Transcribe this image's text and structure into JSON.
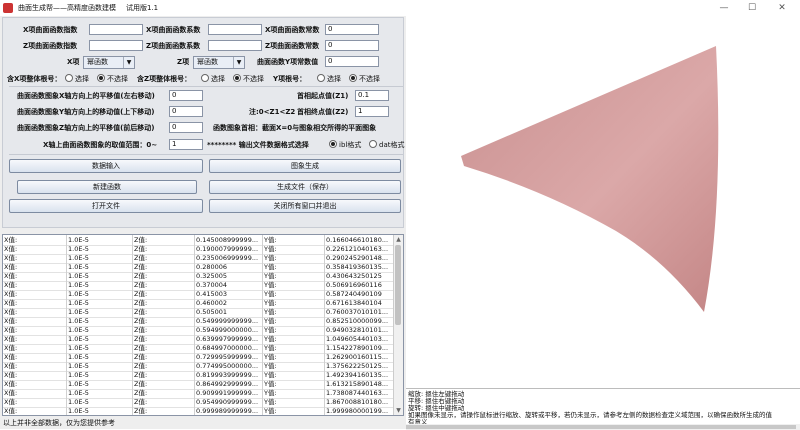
{
  "window": {
    "title": "曲面生成帮——高精度函数建模",
    "version": "试用版1.1",
    "controls": [
      "—",
      "☐",
      "✕"
    ]
  },
  "form": {
    "x_exp_label": "X项曲面函数指数",
    "x_coef_label": "X项曲面函数系数",
    "x_const_label": "X项曲面函数常数",
    "x_const_value": "0",
    "z_exp_label": "Z项曲面函数指数",
    "z_coef_label": "Z项曲面函数系数",
    "z_const_label": "Z项曲面函数常数",
    "z_const_value": "0",
    "x_term_label": "X项",
    "x_term_select": "幂函数",
    "z_term_label": "Z项",
    "z_term_select": "幂函数",
    "y_const_label": "曲面函数Y项常数值",
    "y_const_value": "0",
    "x_sign_label": "含X项整体根号：",
    "z_sign_label": "含Z项整体根号：",
    "y_sign_label": "Y项根号：",
    "opt_select": "选择",
    "opt_unselect": "不选择",
    "x_shift_label": "曲面函数图象X轴方向上的平移值(左右移动)",
    "x_shift_value": "0",
    "y_shift_label": "曲面函数图象Y轴方向上的移动值(上下移动)",
    "y_shift_value": "0",
    "z_shift_label": "曲面函数图象Z轴方向上的平移值(前后移动)",
    "z_shift_value": "0",
    "z1_label": "首相起点值(Z1)",
    "z1_value": "0.1",
    "z2_label": "首相终点值(Z2)",
    "z2_value": "1",
    "note_label": "注:0<Z1<Z2",
    "first_term_note": "函数图象首相：截面X=0与图象相交所得的平面图象",
    "x_range_label": "X轴上曲面函数图象的取值范围：0~",
    "x_range_value": "1",
    "format_label": "******** 输出文件数据格式选择",
    "fmt_ibl": "ibl格式",
    "fmt_dat": "dat格式"
  },
  "buttons": {
    "data_input": "数据输入",
    "image_gen": "图象生成",
    "new_func": "新建函数",
    "gen_file": "生成文件（保存）",
    "open_file": "打开文件",
    "close_all": "关闭所有窗口并退出"
  },
  "table": {
    "x_label": "X值:",
    "z_label": "Z值:",
    "y_label": "Y值:",
    "rows": [
      {
        "x": "1.0E-5",
        "z": "0.145008999999...",
        "y": "0.166046610180..."
      },
      {
        "x": "1.0E-5",
        "z": "0.190007999999...",
        "y": "0.226121040163..."
      },
      {
        "x": "1.0E-5",
        "z": "0.235006999999...",
        "y": "0.290245290148..."
      },
      {
        "x": "1.0E-5",
        "z": "0.280006",
        "y": "0.358419360135..."
      },
      {
        "x": "1.0E-5",
        "z": "0.325005",
        "y": "0.430643250125"
      },
      {
        "x": "1.0E-5",
        "z": "0.370004",
        "y": "0.506916960116"
      },
      {
        "x": "1.0E-5",
        "z": "0.415003",
        "y": "0.587240490109"
      },
      {
        "x": "1.0E-5",
        "z": "0.460002",
        "y": "0.671613840104"
      },
      {
        "x": "1.0E-5",
        "z": "0.505001",
        "y": "0.760037010101..."
      },
      {
        "x": "1.0E-5",
        "z": "0.549999999999...",
        "y": "0.852510000099..."
      },
      {
        "x": "1.0E-5",
        "z": "0.594999000000...",
        "y": "0.949032810101..."
      },
      {
        "x": "1.0E-5",
        "z": "0.639997999999...",
        "y": "1.049605440103..."
      },
      {
        "x": "1.0E-5",
        "z": "0.684997000000...",
        "y": "1.154227890109..."
      },
      {
        "x": "1.0E-5",
        "z": "0.729995999999...",
        "y": "1.262900160115..."
      },
      {
        "x": "1.0E-5",
        "z": "0.774995000000...",
        "y": "1.375622250125..."
      },
      {
        "x": "1.0E-5",
        "z": "0.819993999999...",
        "y": "1.492394160135..."
      },
      {
        "x": "1.0E-5",
        "z": "0.864992999999...",
        "y": "1.613215890148..."
      },
      {
        "x": "1.0E-5",
        "z": "0.909991999999...",
        "y": "1.738087440163..."
      },
      {
        "x": "1.0E-5",
        "z": "0.954990999999...",
        "y": "1.867008810180..."
      },
      {
        "x": "1.0E-5",
        "z": "0.999989999999...",
        "y": "1.999980000199..."
      }
    ]
  },
  "status": {
    "left": "以上并非全部数据，仅为您提供参考"
  },
  "log": {
    "lines": [
      "缩放: 摁住左键拖动",
      "平移: 摁住右键拖动",
      "旋转: 摁住中键拖动",
      "如果图像未显示，请操作鼠标进行缩放、旋转或平移，若仍未显示，请参考左侧的数据检查定义域范围，以确保函数所生成的值",
      "有意义"
    ]
  },
  "colors": {
    "surface": "#d4a0a0",
    "surface_dark": "#c48e8e",
    "panel": "#eeeeee"
  }
}
